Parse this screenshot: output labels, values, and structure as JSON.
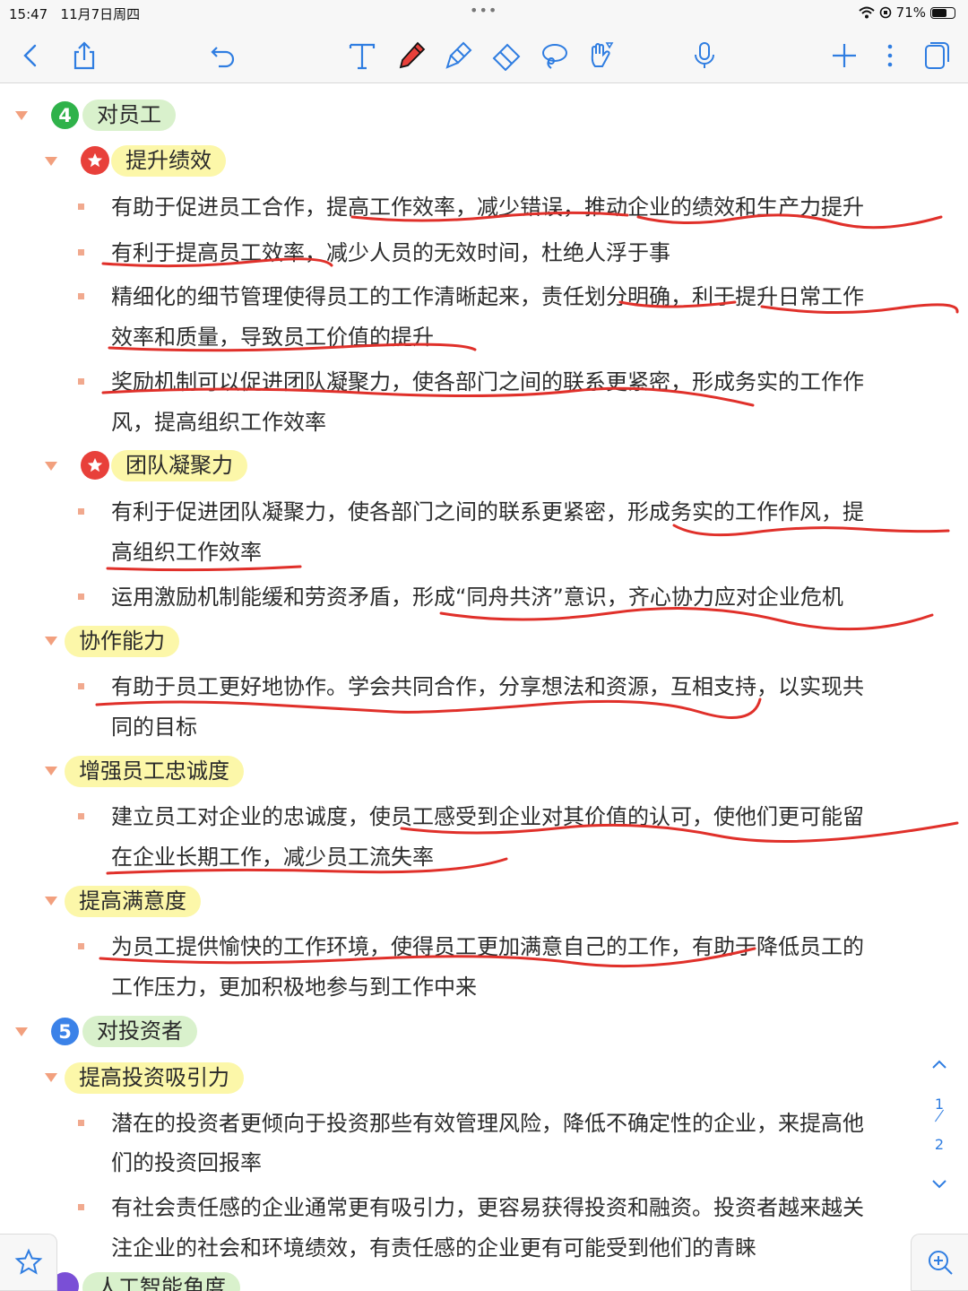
{
  "status": {
    "time": "15:47",
    "date": "11月7日周四",
    "dots": "•••",
    "battery_text": "71%",
    "battery_level": 0.71
  },
  "toolbar_icons": [
    "chevron-left-icon",
    "share-icon",
    "undo-icon",
    "text-tool-icon",
    "pen-icon",
    "highlighter-icon",
    "eraser-icon",
    "lasso-icon",
    "shape-hand-icon",
    "microphone-icon",
    "plus-icon",
    "more-icon",
    "pages-icon"
  ],
  "colors": {
    "accent": "#2f7de1",
    "pen": "#e8403a",
    "green_pill": "#d9f1cc",
    "yellow_pill": "#fcf7a9",
    "bullet": "#f1a98e",
    "triangle": "#f2a07e",
    "badge4": "#2fb24a",
    "badge5": "#3b82e8"
  },
  "outline": {
    "section4": {
      "number": "4",
      "title": "对员工"
    },
    "perf": {
      "title": "提升绩效"
    },
    "perf_b1_l1": "有助于促进员工合作，提高工作效率，减少错误，推动企业的绩效和生产力提升",
    "perf_b2_l1": "有利于提高员工效率，减少人员的无效时间，杜绝人浮于事",
    "perf_b3_l1": "精细化的细节管理使得员工的工作清晰起来，责任划分明确，利于提升日常工作",
    "perf_b3_l2": "效率和质量，导致员工价值的提升",
    "perf_b4_l1": "奖励机制可以促进团队凝聚力，使各部门之间的联系更紧密，形成务实的工作作",
    "perf_b4_l2": "风，提高组织工作效率",
    "team": {
      "title": "团队凝聚力"
    },
    "team_b1_l1": "有利于促进团队凝聚力，使各部门之间的联系更紧密，形成务实的工作作风，提",
    "team_b1_l2": "高组织工作效率",
    "team_b2_l1": "运用激励机制能缓和劳资矛盾，形成“同舟共济”意识，齐心协力应对企业危机",
    "coop": {
      "title": "协作能力"
    },
    "coop_b1_l1": "有助于员工更好地协作。学会共同合作，分享想法和资源，互相支持，以实现共",
    "coop_b1_l2": "同的目标",
    "loyal": {
      "title": "增强员工忠诚度"
    },
    "loyal_b1_l1": "建立员工对企业的忠诚度，使员工感受到企业对其价值的认可，使他们更可能留",
    "loyal_b1_l2": "在企业长期工作，减少员工流失率",
    "satis": {
      "title": "提高满意度"
    },
    "satis_b1_l1": "为员工提供愉快的工作环境，使得员工更加满意自己的工作，有助于降低员工的",
    "satis_b1_l2": "工作压力，更加积极地参与到工作中来",
    "section5": {
      "number": "5",
      "title": "对投资者"
    },
    "invest": {
      "title": "提高投资吸引力"
    },
    "invest_b1_l1": "潜在的投资者更倾向于投资那些有效管理风险，降低不确定性的企业，来提高他",
    "invest_b1_l2": "们的投资回报率",
    "invest_b2_l1": "有社会责任感的企业通常更有吸引力，更容易获得投资和融资。投资者越来越关",
    "invest_b2_l2": "注企业的社会和环境绩效，有责任感的企业更有可能受到他们的青睐",
    "section6": {
      "title": "人工智能角度"
    }
  },
  "pager": {
    "current": "1",
    "total": "2"
  }
}
